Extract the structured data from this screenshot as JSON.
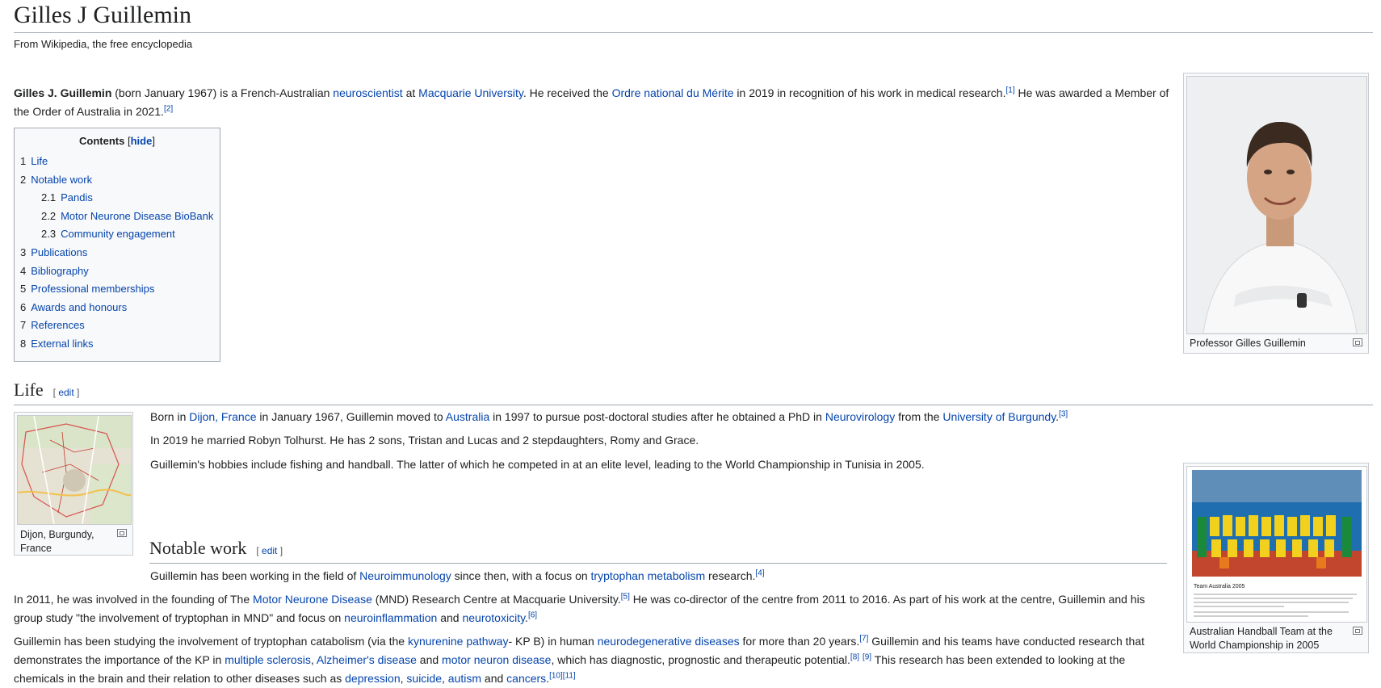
{
  "page": {
    "title": "Gilles J Guillemin",
    "tagline": "From Wikipedia, the free encyclopedia"
  },
  "lead": {
    "bold_name": "Gilles J. Guillemin",
    "t1": " (born January 1967) is a French-Australian ",
    "l1": "neuroscientist",
    "t2": " at ",
    "l2": "Macquarie University",
    "t3": ". He received the ",
    "l3": "Ordre national du Mérite",
    "t4": " in 2019 in recognition of his work in medical research.",
    "r1": "[1]",
    "t5": " He was awarded a Member of the Order of Australia in 2021.",
    "r2": "[2]"
  },
  "toc": {
    "title": "Contents",
    "hide_open": "[",
    "hide": "hide",
    "hide_close": "]",
    "items": [
      {
        "num": "1",
        "label": "Life"
      },
      {
        "num": "2",
        "label": "Notable work"
      },
      {
        "num": "2.1",
        "label": "Pandis"
      },
      {
        "num": "2.2",
        "label": "Motor Neurone Disease BioBank"
      },
      {
        "num": "2.3",
        "label": "Community engagement"
      },
      {
        "num": "3",
        "label": "Publications"
      },
      {
        "num": "4",
        "label": "Bibliography"
      },
      {
        "num": "5",
        "label": "Professional memberships"
      },
      {
        "num": "6",
        "label": "Awards and honours"
      },
      {
        "num": "7",
        "label": "References"
      },
      {
        "num": "8",
        "label": "External links"
      }
    ]
  },
  "portrait": {
    "caption": "Professor Gilles Guillemin"
  },
  "map": {
    "caption": "Dijon, Burgundy, France"
  },
  "team_photo": {
    "caption": "Australian Handball Team at the World Championship in 2005",
    "inset_title": "Team Australia 2005"
  },
  "life": {
    "heading": "Life",
    "edit_open": "[ ",
    "edit": "edit",
    "edit_close": " ]",
    "p1": {
      "t1": "Born in ",
      "l1": "Dijon, France",
      "t2": " in January 1967, Guillemin moved to ",
      "l2": "Australia",
      "t3": " in 1997 to pursue post-doctoral studies after he obtained a PhD in ",
      "l3": "Neurovirology",
      "t4": " from the ",
      "l4": "University of Burgundy",
      "t5": ".",
      "r1": "[3]"
    },
    "p2": "In 2019 he married Robyn Tolhurst. He has 2 sons, Tristan and Lucas and 2 stepdaughters, Romy and Grace.",
    "p3": "Guillemin's hobbies include fishing and handball. The latter of which he competed in at an elite level, leading to the World Championship in Tunisia in 2005."
  },
  "notable": {
    "heading": "Notable work",
    "edit_open": "[ ",
    "edit": "edit",
    "edit_close": " ]",
    "p1": {
      "t1": "Guillemin has been working in the field of ",
      "l1": "Neuroimmunology",
      "t2": " since then, with a focus on ",
      "l2": "tryptophan metabolism",
      "t3": " research.",
      "r1": "[4]"
    },
    "p2": {
      "t1": "In 2011, he was involved in the founding of The ",
      "l1": "Motor Neurone Disease",
      "t2": " (MND) Research Centre at Macquarie University.",
      "r1": "[5]",
      "t3": " He was co-director of the centre from 2011 to 2016. As part of his work at the centre, Guillemin and his group study \"the involvement of tryptophan in MND\" and focus on ",
      "l2": "neuroinflammation",
      "t4": " and ",
      "l3": "neurotoxicity",
      "t5": ".",
      "r2": "[6]"
    },
    "p3": {
      "t1": "Guillemin has been studying the involvement of tryptophan catabolism (via the ",
      "l1": "kynurenine pathway",
      "t2": "- KP B) in human ",
      "l2": "neurodegenerative diseases",
      "t3": " for more than 20 years.",
      "r1": "[7]",
      "t4": " Guillemin and his teams have conducted research that demonstrates the importance of the KP in ",
      "l3": "multiple sclerosis",
      "t5": ", ",
      "l4": "Alzheimer's disease",
      "t6": " and ",
      "l5": "motor neuron disease",
      "t7": ", which has diagnostic, prognostic and therapeutic potential.",
      "r2": "[8]",
      "t8": " ",
      "r3": "[9]",
      "t9": " This research has been extended to looking at the chemicals in the brain and their relation to other diseases such as ",
      "l6": "depression",
      "t10": ", ",
      "l7": "suicide",
      "t11": ", ",
      "l8": "autism",
      "t12": " and ",
      "l9": "cancers",
      "t13": ".",
      "r4": "[10]",
      "r5": "[11]"
    }
  }
}
